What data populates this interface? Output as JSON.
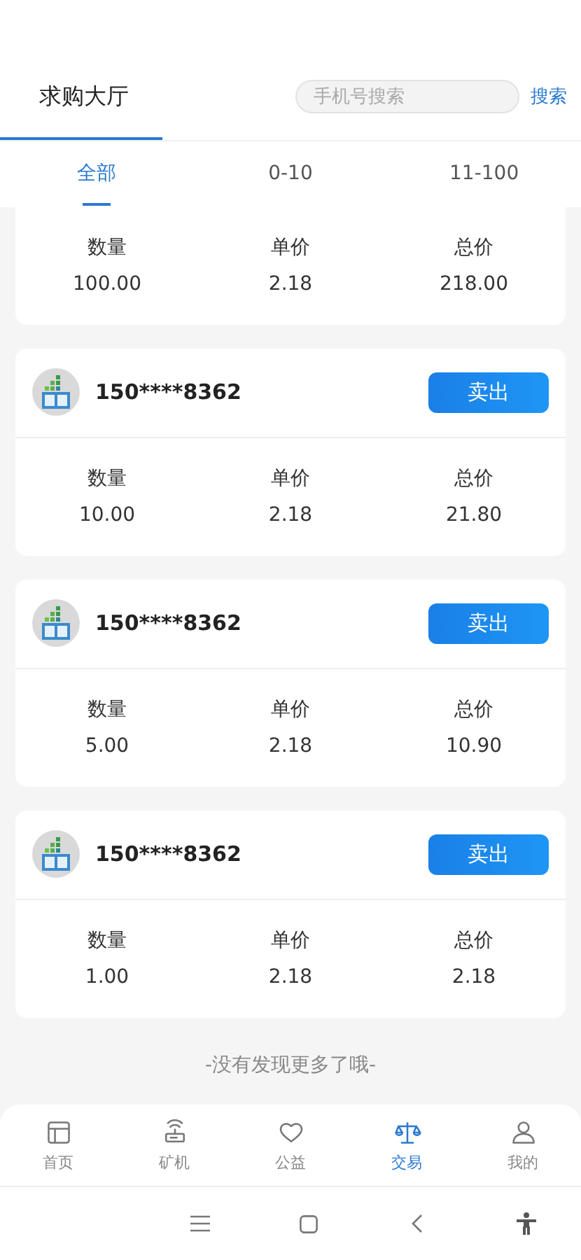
{
  "header": {
    "title": "求购大厅",
    "search": {
      "placeholder": "手机号搜索"
    },
    "search_button": "搜索"
  },
  "tabs": [
    {
      "label": "全部",
      "selected": true
    },
    {
      "label": "0-10",
      "selected": false
    },
    {
      "label": "11-100",
      "selected": false
    }
  ],
  "orders": [
    {
      "stats": [
        {
          "label": "数量",
          "value": "100.00"
        },
        {
          "label": "单价",
          "value": "2.18"
        },
        {
          "label": "总价",
          "value": "218.00"
        }
      ]
    },
    {
      "seller": "150****8362",
      "button": "卖出",
      "stats": [
        {
          "label": "数量",
          "value": "10.00"
        },
        {
          "label": "单价",
          "value": "2.18"
        },
        {
          "label": "总价",
          "value": "21.80"
        }
      ]
    },
    {
      "seller": "150****8362",
      "button": "卖出",
      "stats": [
        {
          "label": "数量",
          "value": "5.00"
        },
        {
          "label": "单价",
          "value": "2.18"
        },
        {
          "label": "总价",
          "value": "10.90"
        }
      ]
    },
    {
      "seller": "150****8362",
      "button": "卖出",
      "stats": [
        {
          "label": "数量",
          "value": "1.00"
        },
        {
          "label": "单价",
          "value": "2.18"
        },
        {
          "label": "总价",
          "value": "2.18"
        }
      ]
    }
  ],
  "end_note": "-没有发现更多了哦-",
  "nav": [
    {
      "label": "首页",
      "kind": "home",
      "selected": false
    },
    {
      "label": "矿机",
      "kind": "machine",
      "selected": false
    },
    {
      "label": "公益",
      "kind": "heart",
      "selected": false
    },
    {
      "label": "交易",
      "kind": "scale",
      "selected": true
    },
    {
      "label": "我的",
      "kind": "user",
      "selected": false
    }
  ]
}
